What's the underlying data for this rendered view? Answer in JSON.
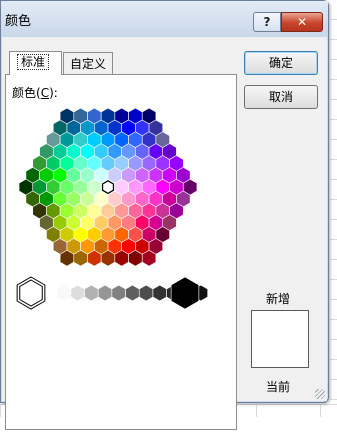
{
  "dialog": {
    "title": "颜色",
    "help_button": "?",
    "close_button": "✕",
    "tabs": [
      {
        "label": "标准",
        "active": true
      },
      {
        "label": "自定义",
        "active": false
      }
    ],
    "colors_label_prefix": "颜色(",
    "colors_label_key": "C",
    "colors_label_suffix": "):",
    "ok_button": "确定",
    "cancel_button": "取消",
    "new_label": "新增",
    "current_label": "当前",
    "new_color": "#FFFFFF",
    "selected_color": "#FFFFFF"
  },
  "palette": {
    "rows": [
      [
        "#003366",
        "#336699",
        "#3366CC",
        "#003399",
        "#000099",
        "#0000CC",
        "#000066"
      ],
      [
        "#006666",
        "#006699",
        "#0099CC",
        "#0066CC",
        "#0033CC",
        "#0000FF",
        "#3333FF",
        "#333399"
      ],
      [
        "#669999",
        "#009999",
        "#33CCCC",
        "#00CCFF",
        "#0099FF",
        "#0066FF",
        "#3366FF",
        "#3333CC",
        "#666699"
      ],
      [
        "#339966",
        "#00CC99",
        "#00FFCC",
        "#00FFFF",
        "#33CCFF",
        "#3399FF",
        "#6699FF",
        "#6666FF",
        "#6600FF",
        "#6600CC"
      ],
      [
        "#339933",
        "#00CC66",
        "#00FF99",
        "#66FFCC",
        "#66FFFF",
        "#66CCFF",
        "#99CCFF",
        "#9999FF",
        "#9966FF",
        "#9933FF",
        "#9900FF"
      ],
      [
        "#006600",
        "#00CC00",
        "#00FF00",
        "#66FF99",
        "#99FFCC",
        "#CCFFFF",
        "#CCCCFF",
        "#CC99FF",
        "#CC66FF",
        "#CC33FF",
        "#CC00FF",
        "#9900CC"
      ],
      [
        "#003300",
        "#009933",
        "#33CC33",
        "#66FF66",
        "#99FF99",
        "#CCFFCC",
        "#FFFFFF",
        "#FFCCFF",
        "#FF99FF",
        "#FF66FF",
        "#FF00FF",
        "#CC00CC",
        "#660066"
      ],
      [
        "#336600",
        "#009900",
        "#66FF33",
        "#99FF66",
        "#CCFF99",
        "#FFFFCC",
        "#FFCCCC",
        "#FF99CC",
        "#FF66CC",
        "#FF33CC",
        "#CC0099",
        "#993399"
      ],
      [
        "#333300",
        "#669900",
        "#99FF33",
        "#CCFF66",
        "#FFFF99",
        "#FFCC99",
        "#FF9999",
        "#FF6699",
        "#FF3399",
        "#CC3399",
        "#990099"
      ],
      [
        "#666633",
        "#99CC00",
        "#CCFF33",
        "#FFFF66",
        "#FFCC66",
        "#FF9966",
        "#FF7C80",
        "#FF0066",
        "#D60093",
        "#993366"
      ],
      [
        "#808000",
        "#CCCC00",
        "#FFFF00",
        "#FFCC00",
        "#FF9933",
        "#FF6600",
        "#FF5050",
        "#CC0066",
        "#660033"
      ],
      [
        "#996633",
        "#CC9900",
        "#FF9900",
        "#CC6600",
        "#FF3300",
        "#FF0000",
        "#CC0000",
        "#990033"
      ],
      [
        "#663300",
        "#996600",
        "#CC3300",
        "#993300",
        "#990000",
        "#800000",
        "#A50021"
      ]
    ],
    "grays": [
      "#F8F8F8",
      "#DDDDDD",
      "#B2B2B2",
      "#969696",
      "#808080",
      "#5F5F5F",
      "#4D4D4D",
      "#333333",
      "#292929",
      "#1C1C1C",
      "#111111"
    ],
    "white_swatch": "#FFFFFF",
    "black_swatch": "#000000",
    "selected_row": 6,
    "selected_col": 6
  }
}
